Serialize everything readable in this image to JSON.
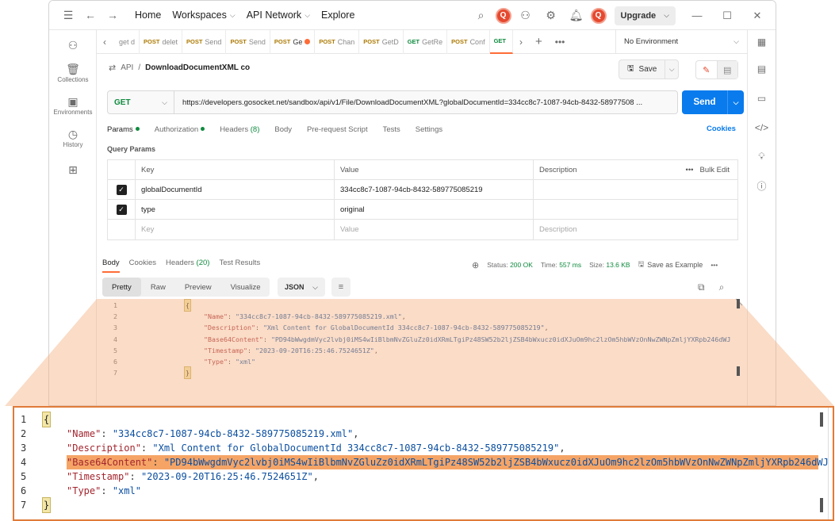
{
  "topbar": {
    "home": "Home",
    "workspaces": "Workspaces",
    "api_network": "API Network",
    "explore": "Explore",
    "upgrade": "Upgrade"
  },
  "sidebar": {
    "items": [
      {
        "label": ""
      },
      {
        "label": "Collections"
      },
      {
        "label": "Environments"
      },
      {
        "label": "History"
      },
      {
        "label": ""
      }
    ]
  },
  "tabs": [
    {
      "method": "",
      "label": "get d"
    },
    {
      "method": "POST",
      "label": "delet"
    },
    {
      "method": "POST",
      "label": "Send"
    },
    {
      "method": "POST",
      "label": "Send"
    },
    {
      "method": "POST",
      "label": "Ge",
      "dot": true
    },
    {
      "method": "POST",
      "label": "Chan"
    },
    {
      "method": "POST",
      "label": "GetD"
    },
    {
      "method": "GET",
      "label": "GetRe"
    },
    {
      "method": "POST",
      "label": "Conf"
    },
    {
      "method": "GET",
      "label": ""
    }
  ],
  "environment": "No Environment",
  "request": {
    "crumb": "API",
    "sep": "/",
    "name": "DownloadDocumentXML co",
    "save_label": "Save",
    "method": "GET",
    "url": "https://developers.gosocket.net/sandbox/api/v1/File/DownloadDocumentXML?globalDocumentId=334cc8c7-1087-94cb-8432-58977508 ...",
    "send_label": "Send",
    "subtabs": {
      "params": "Params",
      "authorization": "Authorization",
      "headers": "Headers",
      "headers_count": "(8)",
      "body": "Body",
      "prerequest": "Pre-request Script",
      "tests": "Tests",
      "settings": "Settings"
    },
    "cookies_label": "Cookies",
    "query_params_title": "Query Params",
    "table": {
      "headers": [
        "Key",
        "Value",
        "Description"
      ],
      "bulk_edit": "Bulk Edit",
      "rows": [
        {
          "key": "globalDocumentId",
          "value": "334cc8c7-1087-94cb-8432-589775085219",
          "description": ""
        },
        {
          "key": "type",
          "value": "original",
          "description": ""
        }
      ],
      "placeholder": {
        "key": "Key",
        "value": "Value",
        "description": "Description"
      }
    }
  },
  "response": {
    "tabs": {
      "body": "Body",
      "cookies": "Cookies",
      "headers": "Headers",
      "headers_count": "(20)",
      "tests": "Test Results"
    },
    "status_label": "Status:",
    "status_value": "200 OK",
    "time_label": "Time:",
    "time_value": "557 ms",
    "size_label": "Size:",
    "size_value": "13.6 KB",
    "save_example": "Save as Example",
    "views": [
      "Pretty",
      "Raw",
      "Preview",
      "Visualize"
    ],
    "format": "JSON",
    "code": [
      {
        "n": "1",
        "text": "{"
      },
      {
        "n": "2",
        "key": "\"Name\"",
        "val": "\"334cc8c7-1087-94cb-8432-589775085219.xml\"",
        "end": ","
      },
      {
        "n": "3",
        "key": "\"Description\"",
        "val": "\"Xml Content for GlobalDocumentId 334cc8c7-1087-94cb-8432-589775085219\"",
        "end": ","
      },
      {
        "n": "4",
        "key": "\"Base64Content\"",
        "val": "\"PD94bWwgdmVyc2lvbj0iMS4wIiBlbmNvZGluZz0idXRmLTgiPz48SW52b2ljZSB4bWxucz0idXJuOm9hc2lzOm5hbWVzOnNwZWNpZmljYXRpb246dWJ",
        "end": ""
      },
      {
        "n": "5",
        "key": "\"Timestamp\"",
        "val": "\"2023-09-20T16:25:46.7524651Z\"",
        "end": ","
      },
      {
        "n": "6",
        "key": "\"Type\"",
        "val": "\"xml\"",
        "end": ""
      },
      {
        "n": "7",
        "text": "}"
      }
    ]
  },
  "colors": {
    "accent": "#ff6c37",
    "send": "#097bed",
    "get": "#0f8a3e",
    "post": "#ad7a03",
    "highlight": "#f5a466",
    "frame": "#e07b39"
  }
}
